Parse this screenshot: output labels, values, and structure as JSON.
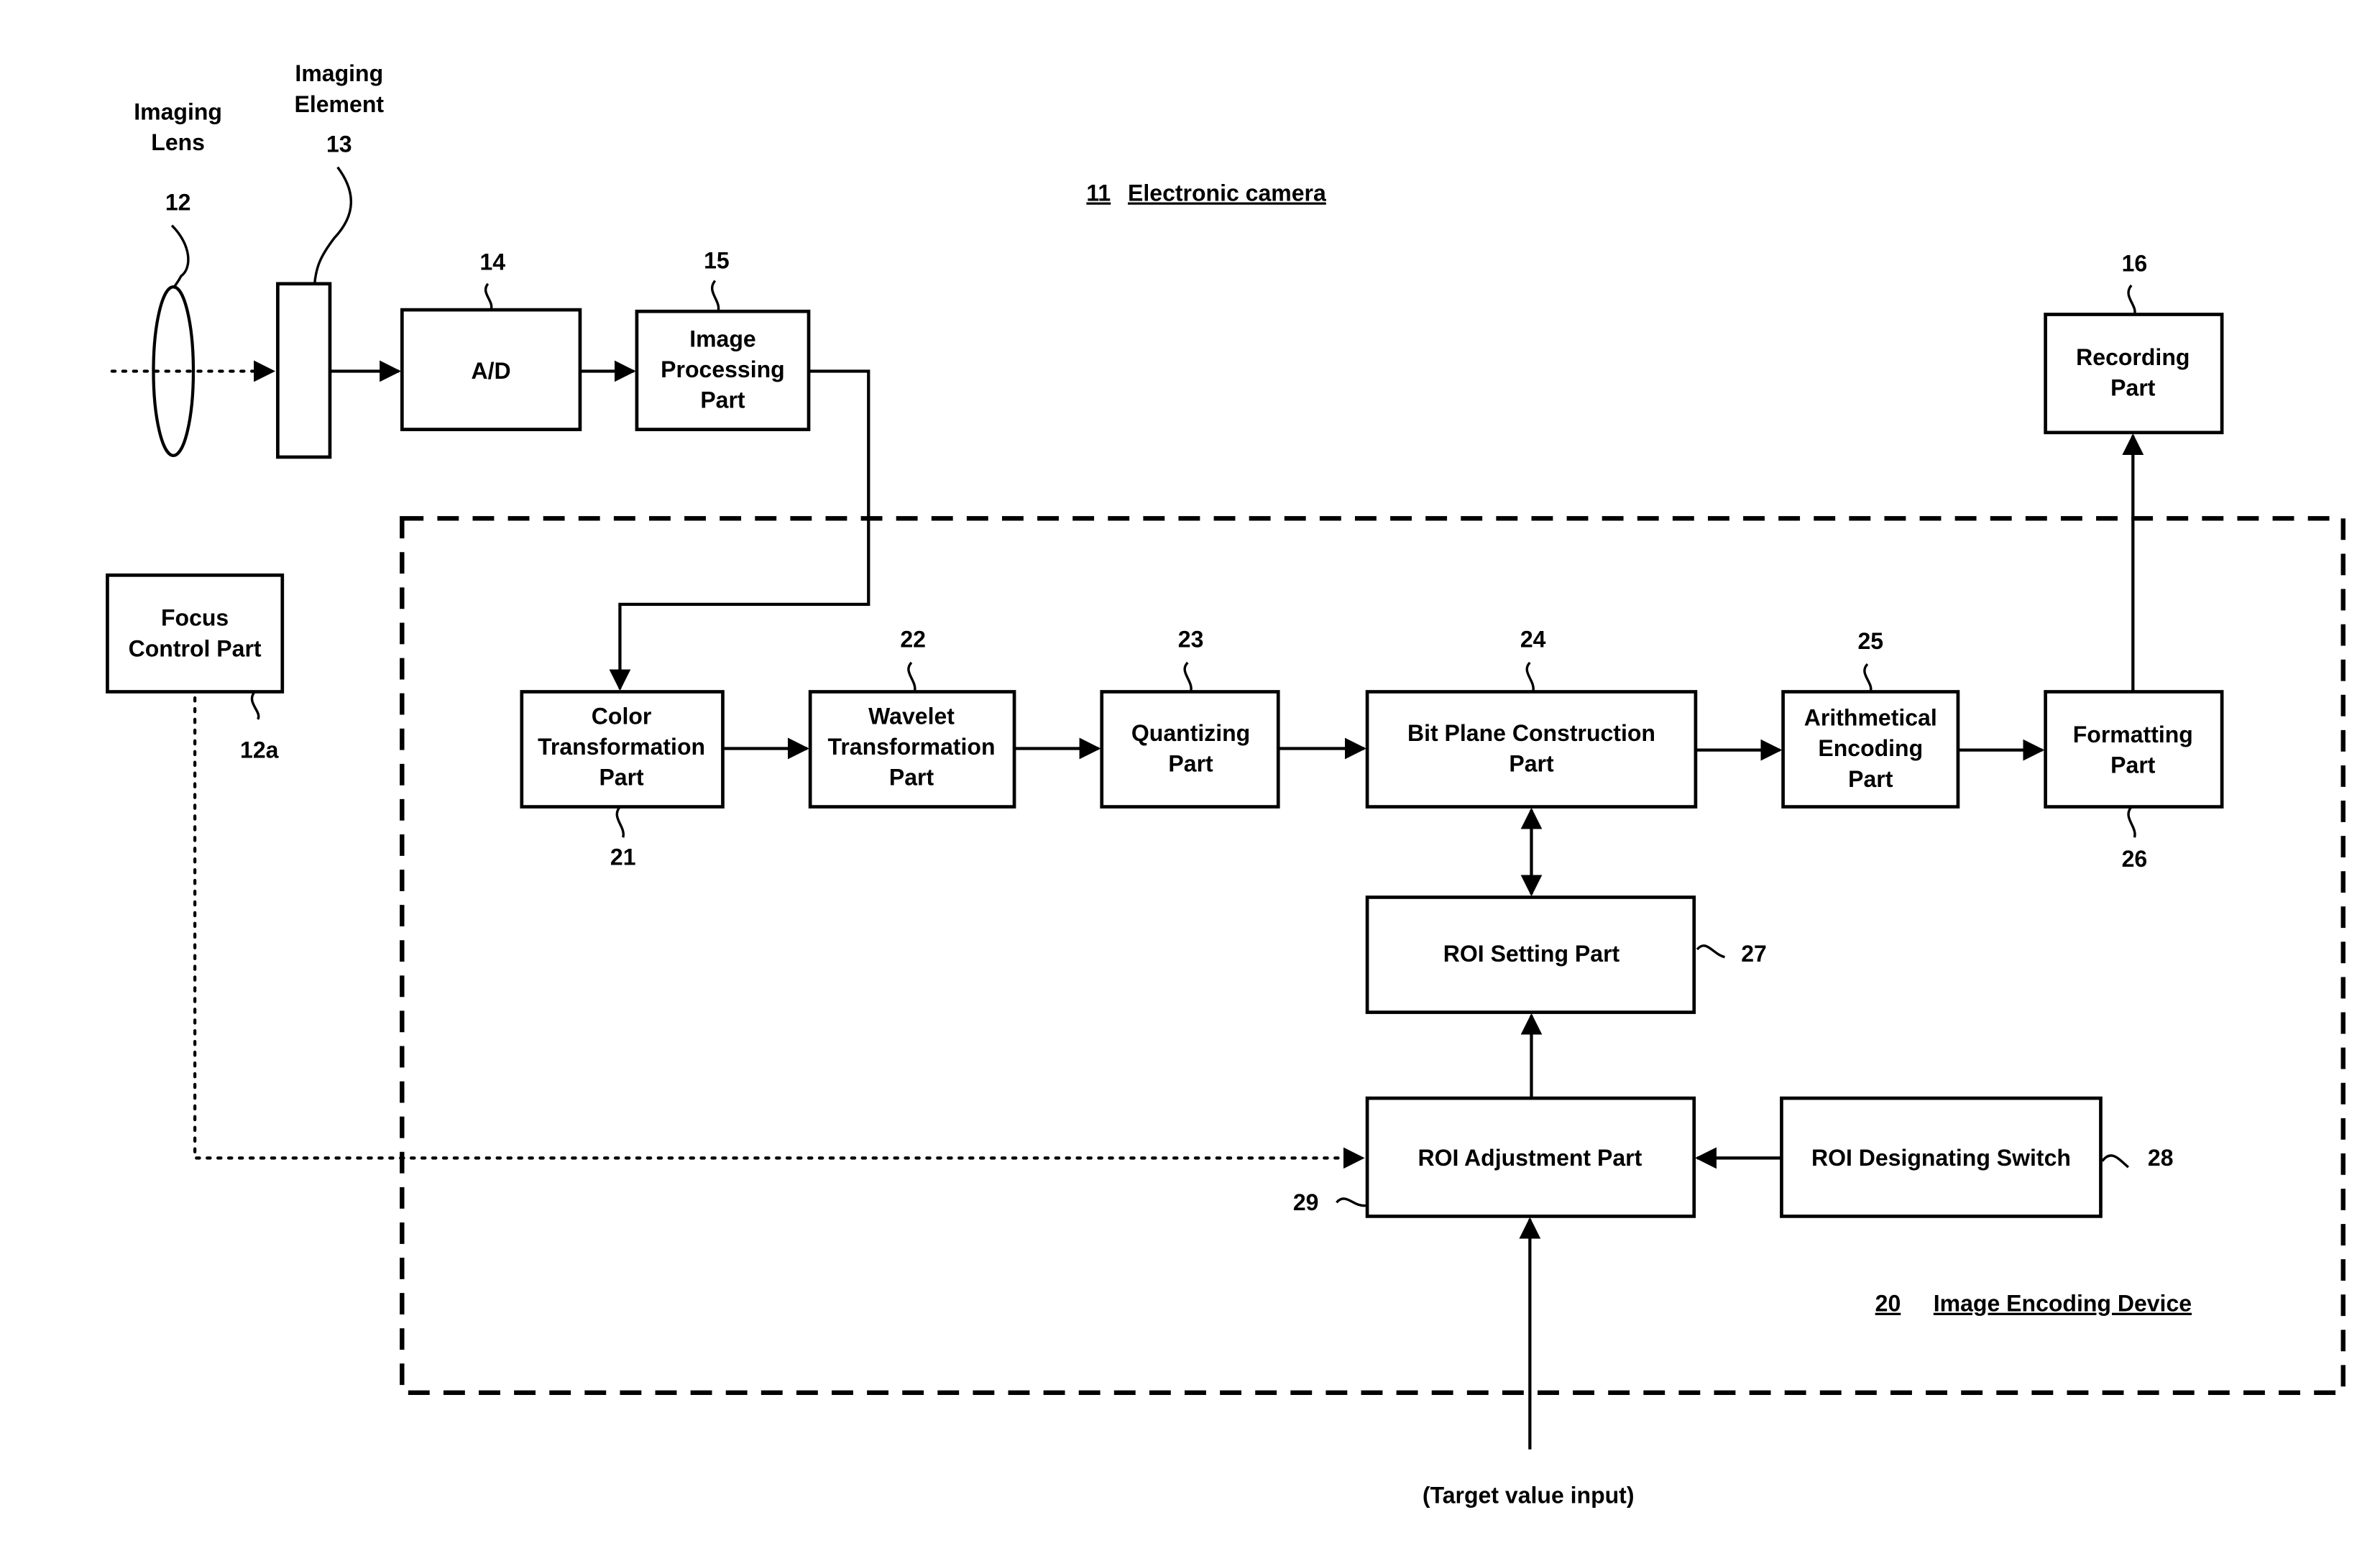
{
  "diagram": {
    "camera_title": {
      "number": "11",
      "label": "Electronic camera"
    },
    "encoder_title": {
      "number": "20",
      "label": "Image Encoding Device"
    },
    "optics": {
      "lens": {
        "number": "12",
        "lines": [
          "Imaging",
          "Lens"
        ]
      },
      "element": {
        "number": "13",
        "lines": [
          "Imaging",
          "Element"
        ]
      }
    },
    "blocks": {
      "ad": {
        "number": "14",
        "lines": [
          "A/D"
        ]
      },
      "image_processing": {
        "number": "15",
        "lines": [
          "Image",
          "Processing",
          "Part"
        ]
      },
      "recording": {
        "number": "16",
        "lines": [
          "Recording",
          "Part"
        ]
      },
      "focus_control": {
        "number": "12a",
        "lines": [
          "Focus",
          "Control Part"
        ]
      },
      "color_transformation": {
        "number": "21",
        "lines": [
          "Color",
          "Transformation",
          "Part"
        ]
      },
      "wavelet_transformation": {
        "number": "22",
        "lines": [
          "Wavelet",
          "Transformation",
          "Part"
        ]
      },
      "quantizing": {
        "number": "23",
        "lines": [
          "Quantizing",
          "Part"
        ]
      },
      "bit_plane": {
        "number": "24",
        "lines": [
          "Bit Plane Construction",
          "Part"
        ]
      },
      "arithmetical_encoding": {
        "number": "25",
        "lines": [
          "Arithmetical",
          "Encoding",
          "Part"
        ]
      },
      "formatting": {
        "number": "26",
        "lines": [
          "Formatting",
          "Part"
        ]
      },
      "roi_setting": {
        "number": "27",
        "lines": [
          "ROI Setting Part"
        ]
      },
      "roi_designating_switch": {
        "number": "28",
        "lines": [
          "ROI Designating Switch"
        ]
      },
      "roi_adjustment": {
        "number": "29",
        "lines": [
          "ROI Adjustment Part"
        ]
      }
    },
    "target_input_label": "(Target value input)"
  }
}
